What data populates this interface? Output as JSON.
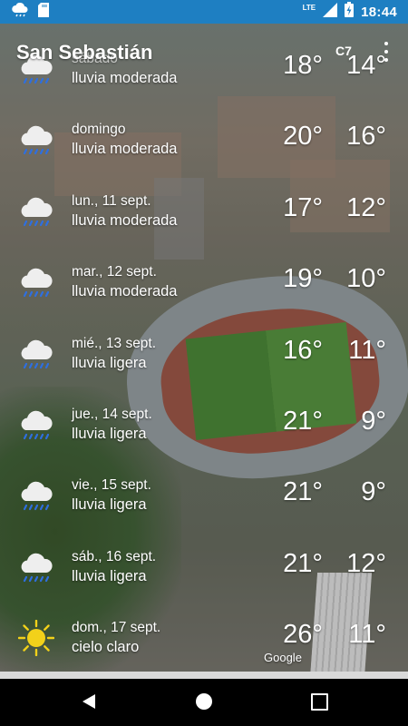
{
  "status_bar": {
    "time": "18:44",
    "network": "LTE",
    "icons": [
      "cloud-notification-icon",
      "sd-card-icon",
      "signal-icon",
      "battery-charging-icon"
    ]
  },
  "header": {
    "city": "San Sebastián",
    "code": "C7",
    "menu_icon": "overflow-menu-icon"
  },
  "forecast": [
    {
      "day": "sábado",
      "condition": "lluvia moderada",
      "high": "18°",
      "low": "14°",
      "icon": "rain-cloud-icon"
    },
    {
      "day": "domingo",
      "condition": "lluvia moderada",
      "high": "20°",
      "low": "16°",
      "icon": "rain-cloud-icon"
    },
    {
      "day": "lun., 11 sept.",
      "condition": "lluvia moderada",
      "high": "17°",
      "low": "12°",
      "icon": "rain-cloud-icon"
    },
    {
      "day": "mar., 12 sept.",
      "condition": "lluvia moderada",
      "high": "19°",
      "low": "10°",
      "icon": "rain-cloud-icon"
    },
    {
      "day": "mié., 13 sept.",
      "condition": "lluvia ligera",
      "high": "16°",
      "low": "11°",
      "icon": "rain-cloud-icon"
    },
    {
      "day": "jue., 14 sept.",
      "condition": "lluvia ligera",
      "high": "21°",
      "low": "9°",
      "icon": "rain-cloud-icon"
    },
    {
      "day": "vie., 15 sept.",
      "condition": "lluvia ligera",
      "high": "21°",
      "low": "9°",
      "icon": "rain-cloud-icon"
    },
    {
      "day": "sáb., 16 sept.",
      "condition": "lluvia ligera",
      "high": "21°",
      "low": "12°",
      "icon": "rain-cloud-icon"
    },
    {
      "day": "dom., 17 sept.",
      "condition": "cielo claro",
      "high": "26°",
      "low": "11°",
      "icon": "sun-icon"
    }
  ],
  "map_attribution": "Google",
  "colors": {
    "status_bar": "#1e7fc2",
    "rain_drops": "#2e6fe0",
    "sun": "#f2d11a"
  }
}
